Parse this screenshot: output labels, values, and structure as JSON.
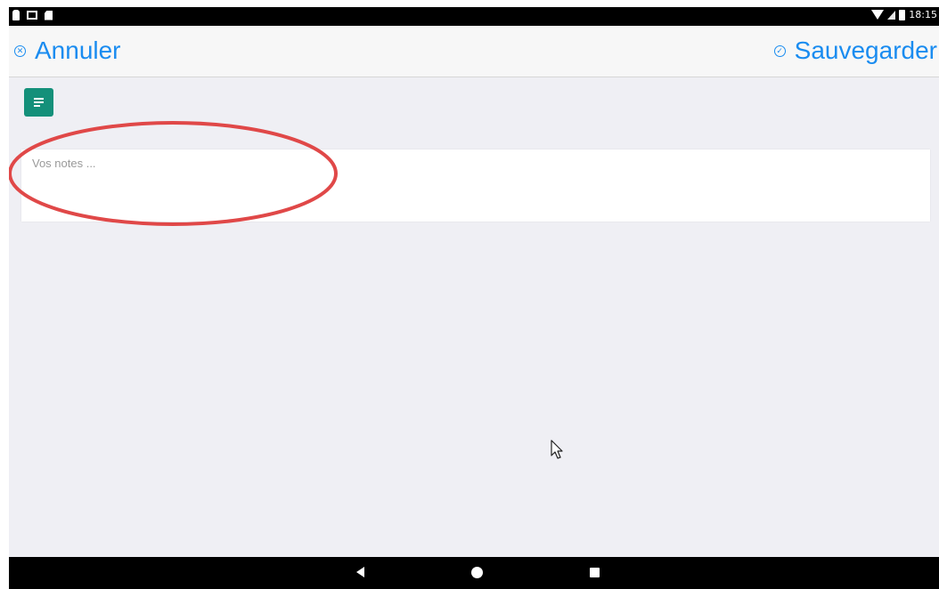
{
  "status_bar": {
    "time": "18:15",
    "icons_left": [
      "person-notification-icon",
      "mail-icon",
      "sd-card-icon"
    ],
    "icons_right": [
      "wifi-icon",
      "signal-icon",
      "battery-icon"
    ]
  },
  "header": {
    "cancel_label": "Annuler",
    "cancel_icon": "cancel-circle-icon",
    "save_label": "Sauvegarder",
    "save_icon": "check-circle-icon",
    "accent_color": "#1a8cf0"
  },
  "note_type": {
    "icon": "note-lines-icon",
    "color": "#14907a"
  },
  "notes": {
    "value": "",
    "placeholder": "Vos notes ..."
  },
  "annotation": {
    "shape": "ellipse",
    "color": "#e04848"
  },
  "bottom_nav": {
    "icons": [
      "back-icon",
      "home-icon",
      "recents-icon"
    ]
  }
}
